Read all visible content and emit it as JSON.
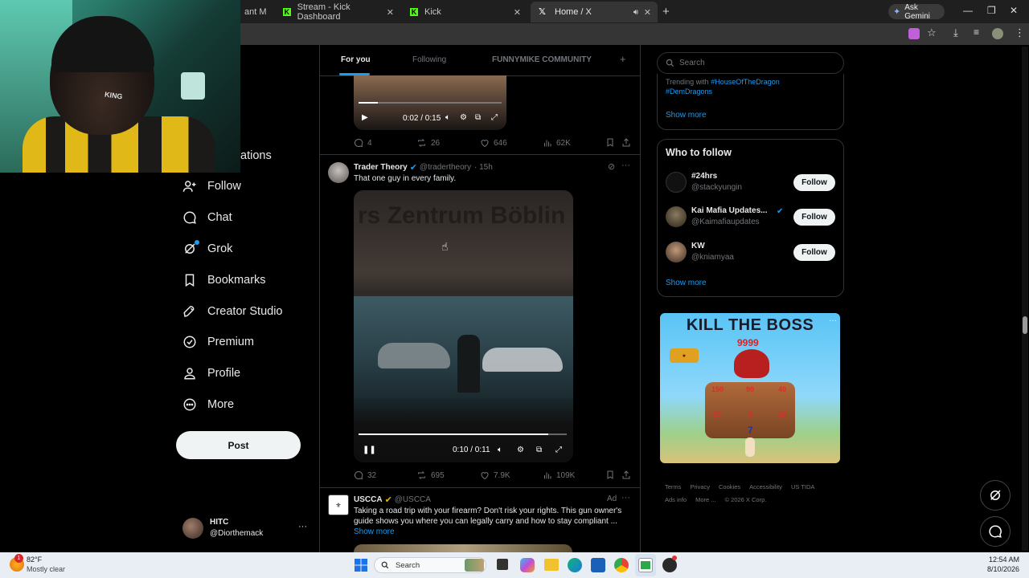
{
  "browser": {
    "tabs": [
      {
        "label": "ant M",
        "active": false
      },
      {
        "label": "Stream - Kick Dashboard",
        "active": false
      },
      {
        "label": "Kick",
        "active": false
      },
      {
        "label": "Home / X",
        "active": true
      }
    ],
    "new_tab": "+",
    "ask_gemini": "Ask Gemini"
  },
  "header": {
    "tabs": [
      "For you",
      "Following",
      "FUNNYMIKE COMMUNITY"
    ],
    "add": "+"
  },
  "sidebar": {
    "partial_items": [
      "e",
      "ations"
    ],
    "items": [
      {
        "label": "Follow",
        "icon": "follow-icon"
      },
      {
        "label": "Chat",
        "icon": "chat-icon"
      },
      {
        "label": "Grok",
        "icon": "grok-icon"
      },
      {
        "label": "Bookmarks",
        "icon": "bookmark-icon"
      },
      {
        "label": "Creator Studio",
        "icon": "rocket-icon"
      },
      {
        "label": "Premium",
        "icon": "premium-icon"
      },
      {
        "label": "Profile",
        "icon": "profile-icon"
      },
      {
        "label": "More",
        "icon": "more-icon"
      }
    ],
    "post_button": "Post",
    "account": {
      "name": "HITC",
      "handle": "@Diorthemack",
      "menu": "···"
    }
  },
  "post1": {
    "video_time": "0:02 / 0:15",
    "stats": {
      "replies": "4",
      "reposts": "26",
      "likes": "646",
      "views": "62K"
    }
  },
  "post2": {
    "name": "Trader Theory",
    "handle": "@tradertheory",
    "time": "· 15h",
    "text": "That one guy in every family.",
    "video_sign": "rs Zentrum Böblin",
    "video_time": "0:10 / 0:11",
    "stats": {
      "replies": "32",
      "reposts": "695",
      "likes": "7.9K",
      "views": "109K"
    }
  },
  "post3": {
    "name": "USCCA",
    "handle": "@USCCA",
    "ad": "Ad",
    "text": "Taking a road trip with your firearm? Don't risk your rights. This gun owner's guide shows you where you can legally carry and how to stay compliant ...",
    "show_more": "Show more"
  },
  "right": {
    "search_placeholder": "Search",
    "trending_prefix": "Trending with",
    "trending_tag1": "#HouseOfTheDragon",
    "trending_tag2": "#DemDragons",
    "show_more": "Show more",
    "who_to_follow": "Who to follow",
    "follow_label": "Follow",
    "suggestions": [
      {
        "name": "#24hrs",
        "handle": "@stackyungin"
      },
      {
        "name": "Kai Mafia Updates...",
        "handle": "@Kaimafiaupdates"
      },
      {
        "name": "KW",
        "handle": "@kniamyaa"
      }
    ],
    "show_more2": "Show more",
    "ad_banner": {
      "title": "KILL THE BOSS",
      "hp": "9999",
      "n1": "150",
      "n2": "90",
      "n3": "40",
      "n4": "25",
      "n5": "0",
      "n6": "20",
      "n7": "7"
    },
    "footer": [
      "Terms",
      "Privacy",
      "Cookies",
      "Accessibility",
      "US TIDA",
      "Ads info",
      "More ...",
      "© 2026 X Corp."
    ]
  },
  "taskbar": {
    "weather_temp": "82°F",
    "weather_desc": "Mostly clear",
    "search": "Search",
    "time": "12:54 AM",
    "date": "8/10/2026"
  },
  "webcam": {
    "cap_text": "KING"
  }
}
